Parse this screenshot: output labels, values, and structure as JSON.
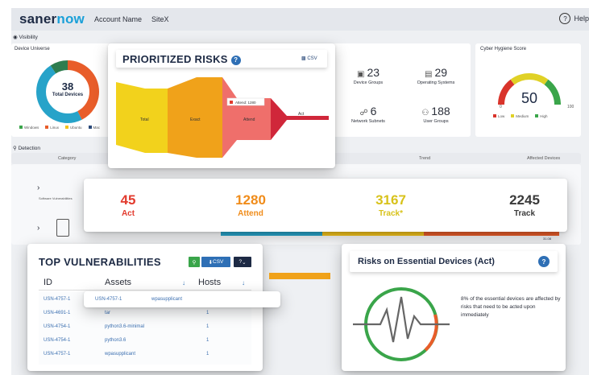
{
  "header": {
    "logo_main": "saner",
    "logo_accent": "now",
    "account_name": "Account Name",
    "site": "SiteX",
    "help": "Help"
  },
  "visibility": {
    "label": "Visibility",
    "device_universe": {
      "title": "Device Universe",
      "count": "38",
      "count_label": "Total Devices",
      "legend": [
        "Windows",
        "Linux",
        "Ubuntu",
        "Mac"
      ]
    },
    "stats": [
      {
        "value": "23",
        "label": "Device Groups"
      },
      {
        "value": "29",
        "label": "Operating Systems"
      },
      {
        "value": "6",
        "label": "Network Subnets"
      },
      {
        "value": "188",
        "label": "User Groups"
      }
    ],
    "hygiene": {
      "title": "Cyber Hygiene Score",
      "score": "50",
      "min": "0",
      "max": "100",
      "legend": [
        "Low",
        "Medium",
        "High"
      ]
    }
  },
  "detection": {
    "label": "Detection",
    "columns": [
      "Category",
      "Trend",
      "Affected Devices"
    ],
    "row1_sub": "Software Vulnerabilities",
    "row2_value": "31.08"
  },
  "prioritized_risks": {
    "title": "PRIORITIZED RISKS",
    "csv": "CSV",
    "help": "?",
    "bands": [
      "Total",
      "Exact",
      "Attend",
      "Act"
    ],
    "tooltip": "Attend: 1280"
  },
  "counters": [
    {
      "value": "45",
      "label": "Act",
      "color": "#e23b2e"
    },
    {
      "value": "1280",
      "label": "Attend",
      "color": "#f08c1a"
    },
    {
      "value": "3167",
      "label": "Track*",
      "color": "#d8c21a"
    },
    {
      "value": "2245",
      "label": "Track",
      "color": "#3a3a3a"
    }
  ],
  "top_vulnerabilities": {
    "title": "TOP VULNERABILITIES",
    "csv": "CSV",
    "help": "?",
    "columns": [
      "ID",
      "Assets",
      "Hosts"
    ],
    "rows": [
      {
        "id": "USN-4757-1",
        "asset": "",
        "hosts": ""
      },
      {
        "id": "USN-4691-1",
        "asset": "tar",
        "hosts": "1"
      },
      {
        "id": "USN-4754-1",
        "asset": "python3.6-minimal",
        "hosts": "1"
      },
      {
        "id": "USN-4754-1",
        "asset": "python3.6",
        "hosts": "1"
      },
      {
        "id": "USN-4757-1",
        "asset": "wpasupplicant",
        "hosts": "1"
      }
    ],
    "tooltip": {
      "id": "USN-4757-1",
      "asset": "wpasupplicant"
    }
  },
  "essential": {
    "title": "Risks on Essential Devices (Act)",
    "help": "?",
    "description": "8% of the essential devices are affected by risks that need to be acted upon immediately"
  },
  "colors": {
    "act": "#e23b2e",
    "attend": "#f08c1a",
    "track_star": "#d8c21a",
    "total": "#f2d21c",
    "accent": "#1aa0d8",
    "green": "#3aa54a"
  }
}
